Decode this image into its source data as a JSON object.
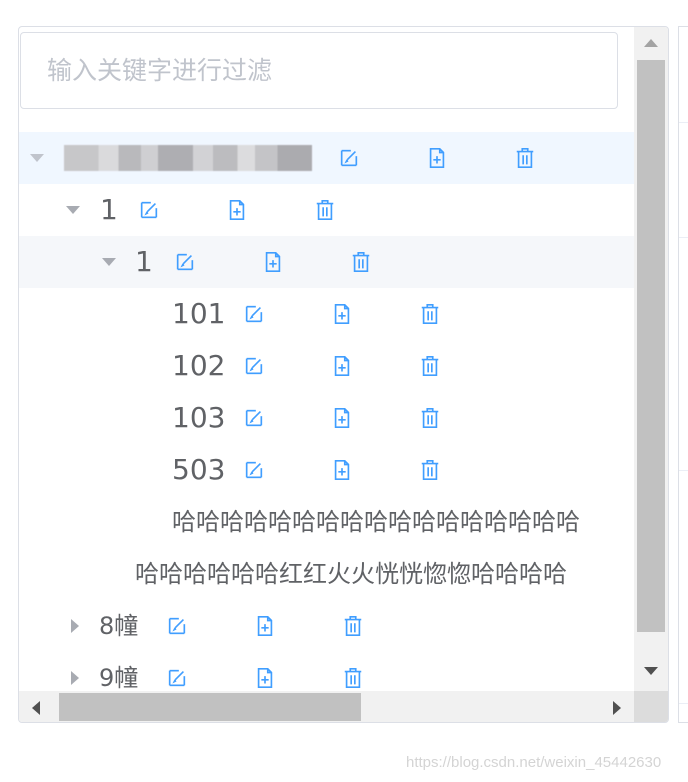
{
  "search": {
    "placeholder": "输入关键字进行过滤",
    "value": ""
  },
  "tree": {
    "nodes": [
      {
        "label": "",
        "level": 0,
        "expanded": true
      },
      {
        "label": "1",
        "level": 1,
        "expanded": true
      },
      {
        "label": "1",
        "level": 2,
        "expanded": true
      },
      {
        "label": "101",
        "level": 3
      },
      {
        "label": "102",
        "level": 3
      },
      {
        "label": "103",
        "level": 3
      },
      {
        "label": "503",
        "level": 3
      },
      {
        "label": "哈哈哈哈哈哈哈哈哈哈哈哈哈哈哈哈哈",
        "level": 3
      },
      {
        "label": "哈哈哈哈哈哈红红火火恍恍惚惚哈哈哈哈",
        "level": 2
      },
      {
        "label": "8幢",
        "level": 1,
        "expanded": false
      },
      {
        "label": "9幢",
        "level": 1,
        "expanded": false
      }
    ]
  },
  "icons": {
    "edit": "edit-icon",
    "add": "add-file-icon",
    "delete": "delete-icon",
    "color": "#409eff"
  },
  "watermark": "https://blog.csdn.net/weixin_45442630"
}
